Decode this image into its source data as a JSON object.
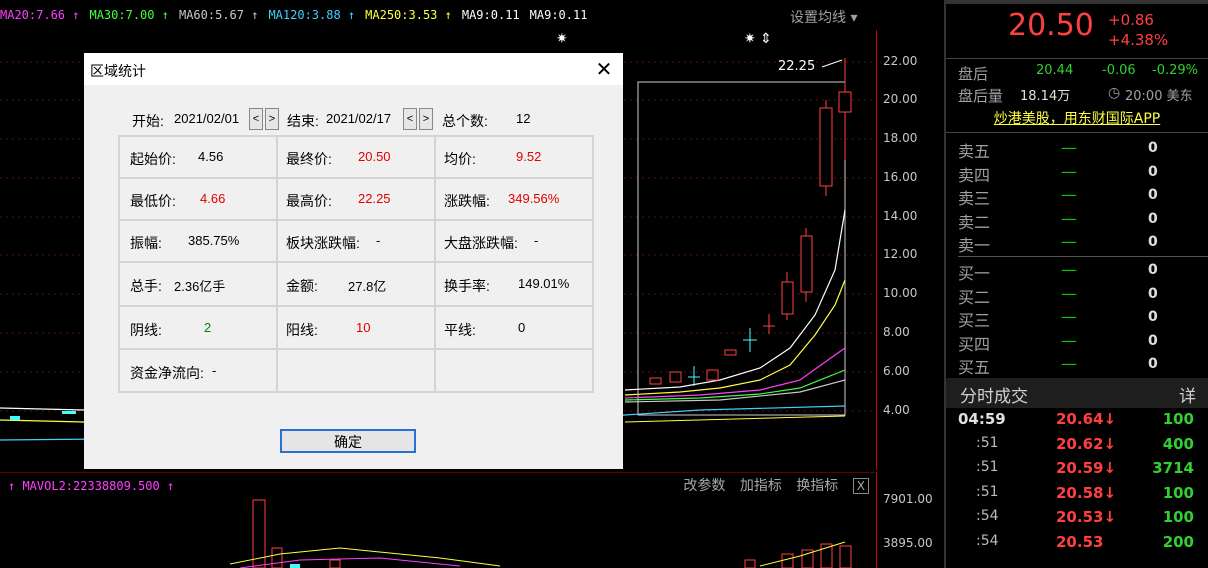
{
  "ma_bar": [
    {
      "text": "MA20:7.66 ↑",
      "color": "#ff40ff"
    },
    {
      "text": "MA30:7.00 ↑",
      "color": "#40ff40"
    },
    {
      "text": "MA60:5.67 ↑",
      "color": "#c8c8c8"
    },
    {
      "text": "MA120:3.88 ↑",
      "color": "#40d0ff"
    },
    {
      "text": "MA250:3.53 ↑",
      "color": "#ffff40"
    },
    {
      "text": "MA9:0.11",
      "color": "#ffffff"
    },
    {
      "text": "MA9:0.11",
      "color": "#ffffff"
    }
  ],
  "set_ma_label": "设置均线 ▾",
  "price_ticks": [
    "22.00",
    "20.00",
    "18.00",
    "16.00",
    "14.00",
    "12.00",
    "10.00",
    "8.00",
    "6.00",
    "4.00"
  ],
  "high_marker": "22.25",
  "volume": {
    "label": "↑ MAVOL2:22338809.500 ↑",
    "tools": [
      "改参数",
      "加指标",
      "换指标"
    ],
    "close_label": "X",
    "ticks": [
      "7901.00",
      "3895.00"
    ]
  },
  "quote": {
    "price": "20.50",
    "change": "+0.86",
    "change_pct": "+4.38%",
    "after_hours_label": "盘后",
    "after_hours_price": "20.44",
    "after_hours_change": "-0.06",
    "after_hours_pct": "-0.29%",
    "after_volume_label": "盘后量",
    "after_volume": "18.14万",
    "clock_time": "20:00 美东",
    "ad_text": "炒港美股，用东财国际APP"
  },
  "order_book": {
    "asks": [
      {
        "label": "卖五",
        "dash": "—",
        "value": "0"
      },
      {
        "label": "卖四",
        "dash": "—",
        "value": "0"
      },
      {
        "label": "卖三",
        "dash": "—",
        "value": "0"
      },
      {
        "label": "卖二",
        "dash": "—",
        "value": "0"
      },
      {
        "label": "卖一",
        "dash": "—",
        "value": "0"
      }
    ],
    "bids": [
      {
        "label": "买一",
        "dash": "—",
        "value": "0"
      },
      {
        "label": "买二",
        "dash": "—",
        "value": "0"
      },
      {
        "label": "买三",
        "dash": "—",
        "value": "0"
      },
      {
        "label": "买四",
        "dash": "—",
        "value": "0"
      },
      {
        "label": "买五",
        "dash": "—",
        "value": "0"
      }
    ]
  },
  "ticks_panel": {
    "title": "分时成交",
    "detail": "详",
    "rows": [
      {
        "time": "04:59",
        "price": "20.64↓",
        "vol": "100"
      },
      {
        "time": ":51",
        "price": "20.62↓",
        "vol": "400"
      },
      {
        "time": ":51",
        "price": "20.59↓",
        "vol": "3714"
      },
      {
        "time": ":51",
        "price": "20.58↓",
        "vol": "100"
      },
      {
        "time": ":54",
        "price": "20.53↓",
        "vol": "100"
      },
      {
        "time": ":54",
        "price": "20.53",
        "vol": "200"
      }
    ]
  },
  "dialog": {
    "title": "区域统计",
    "start_label": "开始:",
    "start_date": "2021/02/01",
    "end_label": "结束:",
    "end_date": "2021/02/17",
    "count_label": "总个数:",
    "count": "12",
    "prev_symbol": "<",
    "next_symbol": ">",
    "cells": [
      {
        "label": "起始价:",
        "value": "4.56",
        "tone": "normal"
      },
      {
        "label": "最终价:",
        "value": "20.50",
        "tone": "red"
      },
      {
        "label": "均价:",
        "value": "9.52",
        "tone": "red"
      },
      {
        "label": "最低价:",
        "value": "4.66",
        "tone": "red"
      },
      {
        "label": "最高价:",
        "value": "22.25",
        "tone": "red"
      },
      {
        "label": "涨跌幅:",
        "value": "349.56%",
        "tone": "red"
      },
      {
        "label": "振幅:",
        "value": "385.75%",
        "tone": "normal"
      },
      {
        "label": "板块涨跌幅:",
        "value": "-",
        "tone": "normal"
      },
      {
        "label": "大盘涨跌幅:",
        "value": "-",
        "tone": "normal"
      },
      {
        "label": "总手:",
        "value": "2.36亿手",
        "tone": "normal"
      },
      {
        "label": "金额:",
        "value": "27.8亿",
        "tone": "normal"
      },
      {
        "label": "换手率:",
        "value": "149.01%",
        "tone": "normal"
      },
      {
        "label": "阴线:",
        "value": "2",
        "tone": "green"
      },
      {
        "label": "阳线:",
        "value": "10",
        "tone": "red"
      },
      {
        "label": "平线:",
        "value": "0",
        "tone": "normal"
      },
      {
        "label": "资金净流向:",
        "value": "-",
        "tone": "normal"
      },
      {
        "label": "",
        "value": "",
        "tone": "normal"
      },
      {
        "label": "",
        "value": "",
        "tone": "normal"
      }
    ],
    "ok_label": "确定",
    "close_symbol": "✕"
  }
}
